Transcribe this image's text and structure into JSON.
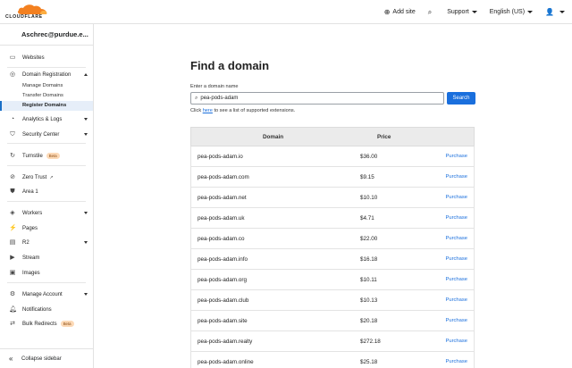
{
  "topbar": {
    "logo_text": "CLOUDFLARE",
    "add_site": "Add site",
    "support": "Support",
    "language": "English (US)"
  },
  "sidebar": {
    "account": "Aschrec@purdue.e...",
    "items": {
      "websites": "Websites",
      "domain_registration": "Domain Registration",
      "manage_domains": "Manage Domains",
      "transfer_domains": "Transfer Domains",
      "register_domains": "Register Domains",
      "analytics_logs": "Analytics & Logs",
      "security_center": "Security Center",
      "turnstile": "Turnstile",
      "zero_trust": "Zero Trust",
      "area1": "Area 1",
      "workers": "Workers",
      "pages": "Pages",
      "r2": "R2",
      "stream": "Stream",
      "images": "Images",
      "manage_account": "Manage Account",
      "notifications": "Notifications",
      "bulk_redirects": "Bulk Redirects"
    },
    "beta_label": "Beta",
    "collapse": "Collapse sidebar"
  },
  "main": {
    "title": "Find a domain",
    "field_label": "Enter a domain name",
    "search_value": "pea-pods-adam",
    "search_button": "Search",
    "hint_prefix": "Click ",
    "hint_link": "here",
    "hint_suffix": " to see a list of supported extensions.",
    "table": {
      "col_domain": "Domain",
      "col_price": "Price",
      "action_label": "Purchase",
      "rows": [
        {
          "domain": "pea-pods-adam.io",
          "price": "$36.00"
        },
        {
          "domain": "pea-pods-adam.com",
          "price": "$9.15"
        },
        {
          "domain": "pea-pods-adam.net",
          "price": "$10.10"
        },
        {
          "domain": "pea-pods-adam.uk",
          "price": "$4.71"
        },
        {
          "domain": "pea-pods-adam.co",
          "price": "$22.00"
        },
        {
          "domain": "pea-pods-adam.info",
          "price": "$16.18"
        },
        {
          "domain": "pea-pods-adam.org",
          "price": "$10.11"
        },
        {
          "domain": "pea-pods-adam.club",
          "price": "$10.13"
        },
        {
          "domain": "pea-pods-adam.site",
          "price": "$20.18"
        },
        {
          "domain": "pea-pods-adam.realty",
          "price": "$272.18"
        },
        {
          "domain": "pea-pods-adam.online",
          "price": "$25.18"
        }
      ]
    }
  },
  "colors": {
    "accent": "#1a6fdd",
    "brand_orange": "#f38020"
  }
}
